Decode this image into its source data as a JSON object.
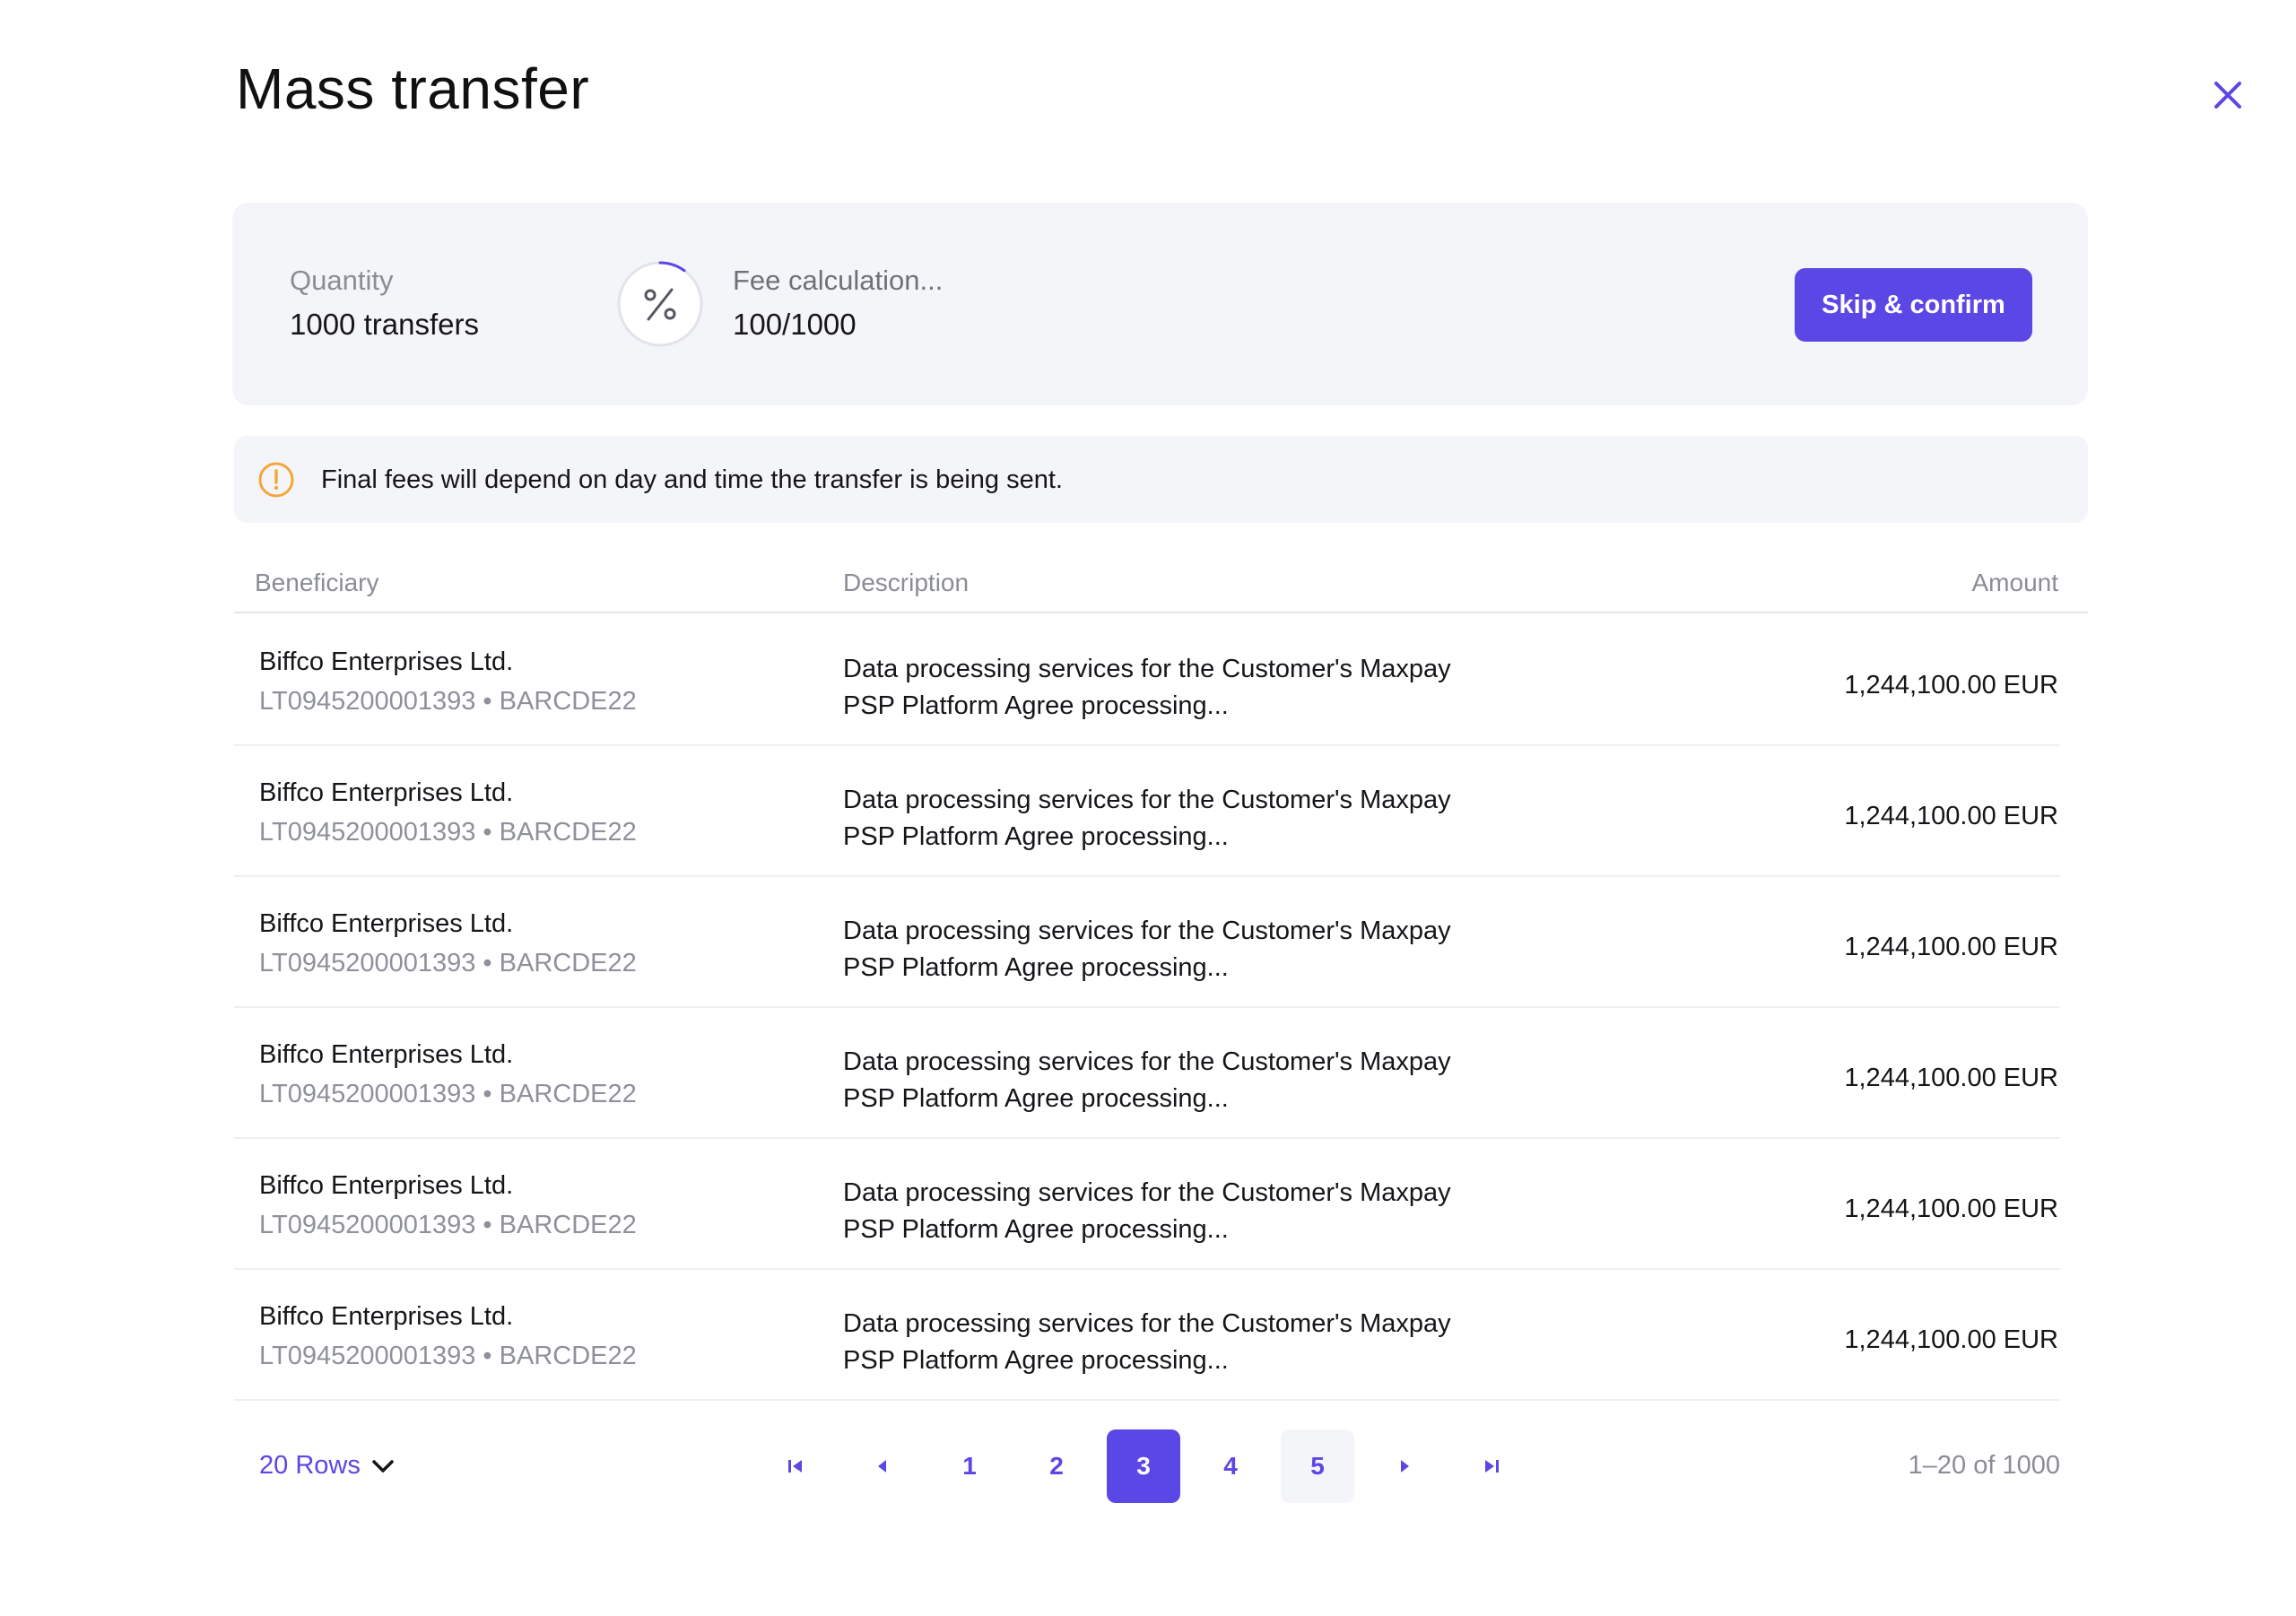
{
  "header": {
    "title": "Mass transfer"
  },
  "summary": {
    "quantity_label": "Quantity",
    "quantity_value": "1000 transfers",
    "fee_label": "Fee calculation...",
    "fee_progress_text": "100/1000",
    "fee_progress": 0.1,
    "skip_label": "Skip & confirm"
  },
  "notice": {
    "text": "Final fees will depend on day and time the transfer is being sent."
  },
  "table": {
    "columns": [
      "Beneficiary",
      "Description",
      "Amount"
    ],
    "rows": [
      {
        "name": "Biffco Enterprises Ltd.",
        "iban": "LT0945200001393 • BARCDE22",
        "desc1": "Data processing services for the Customer's Maxpay",
        "desc2": "PSP Platform Agree processing...",
        "amount": "1,244,100.00 EUR"
      },
      {
        "name": "Biffco Enterprises Ltd.",
        "iban": "LT0945200001393 • BARCDE22",
        "desc1": "Data processing services for the Customer's Maxpay",
        "desc2": "PSP Platform Agree processing...",
        "amount": "1,244,100.00 EUR"
      },
      {
        "name": "Biffco Enterprises Ltd.",
        "iban": "LT0945200001393 • BARCDE22",
        "desc1": "Data processing services for the Customer's Maxpay",
        "desc2": "PSP Platform Agree processing...",
        "amount": "1,244,100.00 EUR"
      },
      {
        "name": "Biffco Enterprises Ltd.",
        "iban": "LT0945200001393 • BARCDE22",
        "desc1": "Data processing services for the Customer's Maxpay",
        "desc2": "PSP Platform Agree processing...",
        "amount": "1,244,100.00 EUR"
      },
      {
        "name": "Biffco Enterprises Ltd.",
        "iban": "LT0945200001393 • BARCDE22",
        "desc1": "Data processing services for the Customer's Maxpay",
        "desc2": "PSP Platform Agree processing...",
        "amount": "1,244,100.00 EUR"
      },
      {
        "name": "Biffco Enterprises Ltd.",
        "iban": "LT0945200001393 • BARCDE22",
        "desc1": "Data processing services for the Customer's Maxpay",
        "desc2": "PSP Platform Agree processing...",
        "amount": "1,244,100.00 EUR"
      }
    ]
  },
  "pagination": {
    "rows_label": "20 Rows",
    "pages": [
      "1",
      "2",
      "3",
      "4",
      "5"
    ],
    "current_page": "3",
    "range_text": "1–20 of 1000"
  },
  "icons": {
    "close": "close-icon",
    "percent": "percent-icon",
    "alert": "alert-circle-icon",
    "chevron": "chevron-down-icon",
    "first": "first-page-icon",
    "prev": "prev-page-icon",
    "next": "next-page-icon",
    "last": "last-page-icon"
  },
  "colors": {
    "accent": "#5b46e6",
    "warning": "#f4a63b",
    "panel": "#f4f5f9",
    "muted": "#8b8d96"
  }
}
